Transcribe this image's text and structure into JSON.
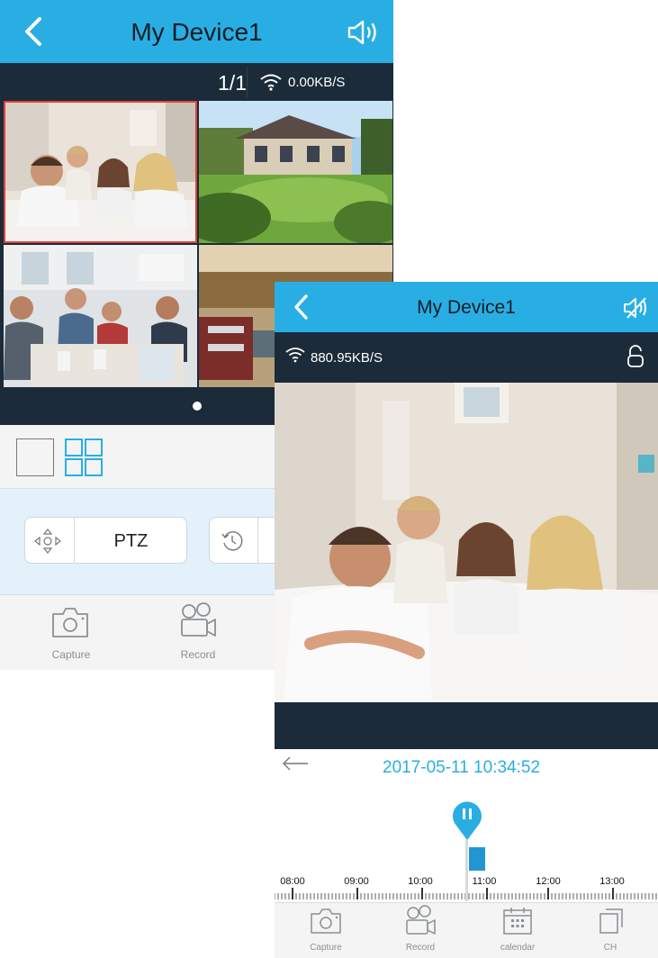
{
  "screen_a": {
    "title": "My Device1",
    "page_indicator": "1/1",
    "speed": "0.00KB/S",
    "ptz_label": "PTZ",
    "toolbar": [
      {
        "label": "Capture",
        "icon": "camera-icon"
      },
      {
        "label": "Record",
        "icon": "video-record-icon"
      }
    ],
    "selected_view": "quad-view",
    "active_page_dot": 1
  },
  "screen_b": {
    "title": "My Device1",
    "speed": "880.95KB/S",
    "timestamp": "2017-05-11 10:34:52",
    "timeline_ticks": [
      "08:00",
      "09:00",
      "10:00",
      "11:00",
      "12:00",
      "13:00"
    ],
    "toolbar": [
      {
        "label": "Capture",
        "icon": "camera-icon"
      },
      {
        "label": "Record",
        "icon": "video-record-icon"
      },
      {
        "label": "calendar",
        "icon": "calendar-icon"
      },
      {
        "label": "CH",
        "icon": "channel-icon"
      }
    ]
  },
  "colors": {
    "accent": "#29aee3",
    "dark_bar": "#1b2b39",
    "selected_border": "#e2403a",
    "record_block": "#2196d3"
  }
}
